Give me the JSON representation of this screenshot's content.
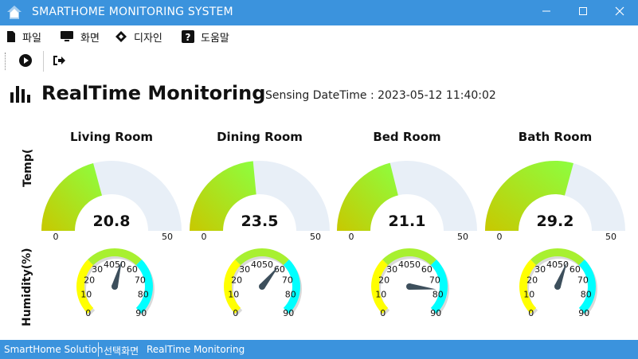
{
  "window": {
    "title": "SMARTHOME MONITORING SYSTEM",
    "controls": [
      "minimize-icon",
      "maximize-icon",
      "close-icon"
    ]
  },
  "menu": {
    "items": [
      {
        "label": "파일",
        "icon": "file-icon"
      },
      {
        "label": "화면",
        "icon": "monitor-icon"
      },
      {
        "label": "디자인",
        "icon": "brush-icon"
      },
      {
        "label": "도움말",
        "icon": "help-icon"
      }
    ]
  },
  "toolbar": {
    "buttons": [
      {
        "icon": "play-circle-icon"
      },
      {
        "icon": "sign-out-icon"
      }
    ]
  },
  "header": {
    "title": "RealTime Monitoring",
    "sensing_label": "Sensing DateTime : 2023-05-12 11:40:02"
  },
  "rows": {
    "temp_label": "Temp(",
    "humidity_label": "Humidity(%)"
  },
  "rooms": [
    {
      "name": "Living Room",
      "temp": "20.8",
      "humidity": 50
    },
    {
      "name": "Dining Room",
      "temp": "23.5",
      "humidity": 58
    },
    {
      "name": "Bed Room",
      "temp": "21.1",
      "humidity": 77
    },
    {
      "name": "Bath Room",
      "temp": "29.2",
      "humidity": 52
    }
  ],
  "temp_gauge": {
    "min": "0",
    "max": "50"
  },
  "humidity_gauge": {
    "ticks": [
      "0",
      "10",
      "20",
      "30",
      "4050",
      "60",
      "70",
      "80",
      "90"
    ],
    "min": 0,
    "max": 90
  },
  "colors": {
    "accent": "#3b93dd",
    "gauge_track": "#e8eff7",
    "gauge_start": "#c8c800",
    "gauge_end": "#8cff40",
    "humidity_low": "#ffff00",
    "humidity_mid": "#a8f030",
    "humidity_high": "#00ffff",
    "needle": "#3d4f5c"
  },
  "statusbar": {
    "app": "SmartHome Solution",
    "screen_label": "선택화면",
    "screen_value": "RealTime Monitoring"
  }
}
